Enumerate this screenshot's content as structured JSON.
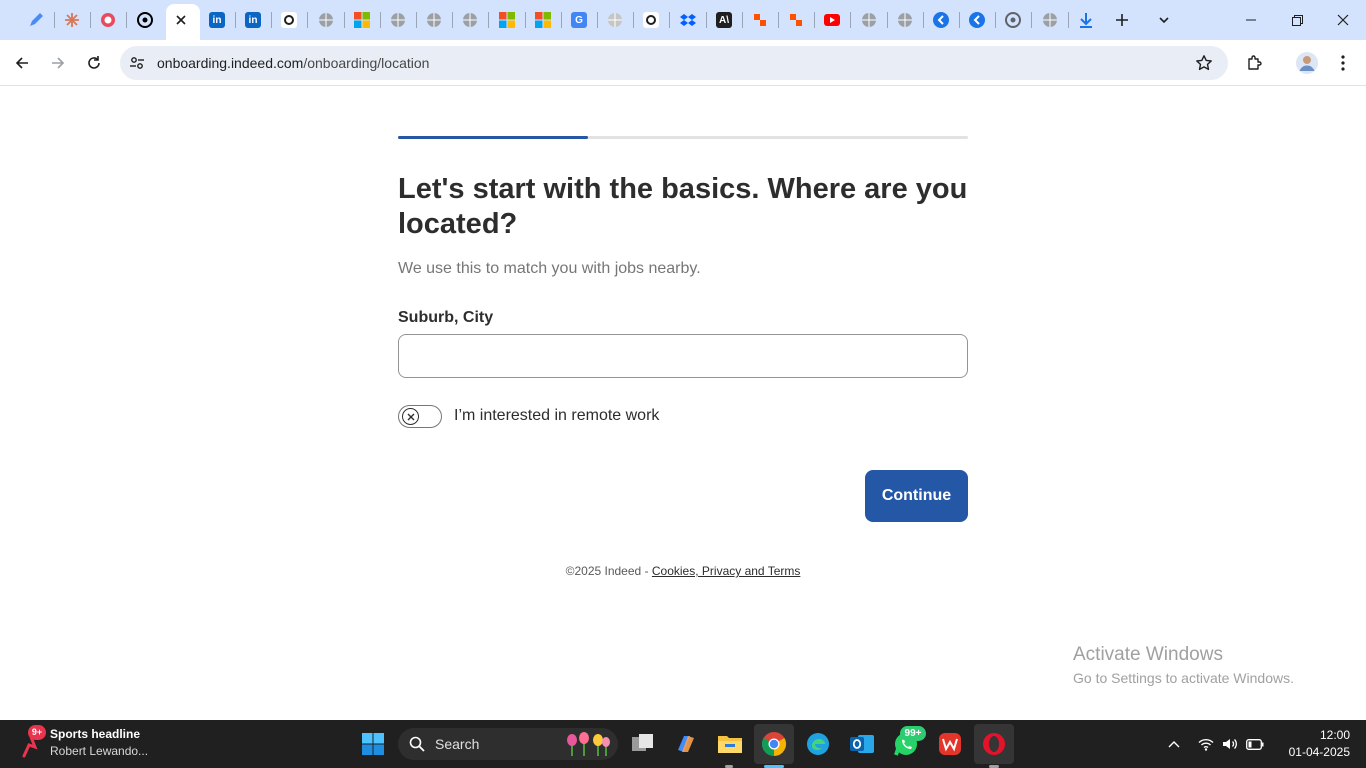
{
  "browser": {
    "tabs": [
      {
        "icon": "pencil-tab-icon",
        "color": "#4c8bf5"
      },
      {
        "icon": "claude-tab-icon",
        "color": "#d97757"
      },
      {
        "icon": "copilot-tab-icon",
        "color": "#e84a5f"
      },
      {
        "icon": "chatgpt-tab-icon",
        "color": "#000000"
      },
      {
        "icon": "close-tab-icon",
        "color": "#1f1f1f",
        "active": true
      },
      {
        "icon": "linkedin-tab-icon",
        "color": "#0a66c2",
        "text": "in"
      },
      {
        "icon": "linkedin-tab-icon",
        "color": "#0a66c2",
        "text": "in"
      },
      {
        "icon": "indeed-tab-icon",
        "color": "#e8e8e8"
      },
      {
        "icon": "globe-tab-icon",
        "color": "#9aa0a6"
      },
      {
        "icon": "microsoft-tab-icon",
        "color": "#f25022"
      },
      {
        "icon": "globe-tab-icon",
        "color": "#9aa0a6"
      },
      {
        "icon": "globe-tab-icon",
        "color": "#9aa0a6"
      },
      {
        "icon": "globe-tab-icon",
        "color": "#9aa0a6"
      },
      {
        "icon": "microsoft-tab-icon",
        "color": "#f25022"
      },
      {
        "icon": "microsoft-tab-icon",
        "color": "#f25022"
      },
      {
        "icon": "google-tab-icon",
        "color": "#4285f4",
        "text": "G"
      },
      {
        "icon": "globe-tab-icon",
        "color": "#c4c7c5"
      },
      {
        "icon": "indeed-tab-icon",
        "color": "#e8e8e8"
      },
      {
        "icon": "dropbox-tab-icon",
        "color": "#0061fe"
      },
      {
        "icon": "anthropic-tab-icon",
        "color": "#1f1f1f",
        "text": "A\\"
      },
      {
        "icon": "zapier-tab-icon",
        "color": "#ff4f00"
      },
      {
        "icon": "zapier-tab-icon",
        "color": "#ff4f00"
      },
      {
        "icon": "youtube-tab-icon",
        "color": "#ff0000"
      },
      {
        "icon": "globe-tab-icon",
        "color": "#9aa0a6"
      },
      {
        "icon": "globe-tab-icon",
        "color": "#9aa0a6"
      },
      {
        "icon": "back-circle-tab-icon",
        "color": "#1a73e8"
      },
      {
        "icon": "back-circle-tab-icon",
        "color": "#1a73e8"
      },
      {
        "icon": "chrome-tab-icon",
        "color": "#5f6368"
      },
      {
        "icon": "globe-tab-icon",
        "color": "#9aa0a6"
      },
      {
        "icon": "download-tab-icon",
        "color": "#1a73e8"
      }
    ],
    "url_host": "onboarding.indeed.com",
    "url_path": "/onboarding/location"
  },
  "page": {
    "progress_fraction": 0.333,
    "heading": "Let's start with the basics. Where are you located?",
    "subtext": "We use this to match you with jobs nearby.",
    "location_label": "Suburb, City",
    "location_value": "",
    "location_placeholder": "",
    "remote_label": "I’m interested in remote work",
    "remote_enabled": false,
    "continue_label": "Continue",
    "footer_prefix": "©2025 Indeed - ",
    "footer_link": "Cookies, Privacy and Terms"
  },
  "watermark": {
    "line1": "Activate Windows",
    "line2": "Go to Settings to activate Windows."
  },
  "taskbar": {
    "news_badge": "9+",
    "news_title": "Sports headline",
    "news_subtitle": "Robert Lewando...",
    "search_label": "Search",
    "whatsapp_badge": "99+",
    "time": "12:00",
    "date": "01-04-2025"
  },
  "colors": {
    "accent": "#2557a7",
    "tabstrip": "#d3e3fd",
    "taskbar": "#202020"
  }
}
